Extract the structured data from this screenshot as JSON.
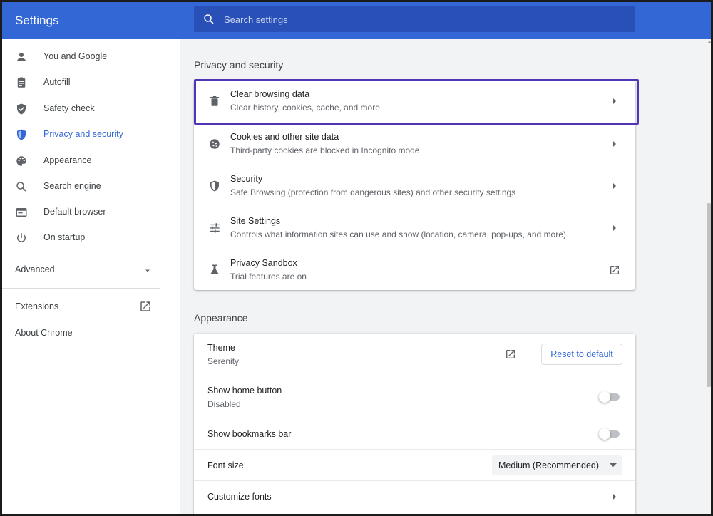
{
  "app": {
    "title": "Settings"
  },
  "search": {
    "placeholder": "Search settings"
  },
  "sidebar": {
    "items": [
      {
        "label": "You and Google",
        "icon": "person-icon"
      },
      {
        "label": "Autofill",
        "icon": "clipboard-icon"
      },
      {
        "label": "Safety check",
        "icon": "shield-check-icon"
      },
      {
        "label": "Privacy and security",
        "icon": "shield-icon",
        "active": true
      },
      {
        "label": "Appearance",
        "icon": "palette-icon"
      },
      {
        "label": "Search engine",
        "icon": "search-icon"
      },
      {
        "label": "Default browser",
        "icon": "browser-icon"
      },
      {
        "label": "On startup",
        "icon": "power-icon"
      }
    ],
    "advanced": "Advanced",
    "extensions": "Extensions",
    "about": "About Chrome"
  },
  "privacy": {
    "title": "Privacy and security",
    "rows": [
      {
        "title": "Clear browsing data",
        "subtitle": "Clear history, cookies, cache, and more",
        "icon": "trash-icon",
        "trailing": "arrow"
      },
      {
        "title": "Cookies and other site data",
        "subtitle": "Third-party cookies are blocked in Incognito mode",
        "icon": "cookie-icon",
        "trailing": "arrow"
      },
      {
        "title": "Security",
        "subtitle": "Safe Browsing (protection from dangerous sites) and other security settings",
        "icon": "shield-icon",
        "trailing": "arrow"
      },
      {
        "title": "Site Settings",
        "subtitle": "Controls what information sites can use and show (location, camera, pop-ups, and more)",
        "icon": "tune-icon",
        "trailing": "arrow"
      },
      {
        "title": "Privacy Sandbox",
        "subtitle": "Trial features are on",
        "icon": "flask-icon",
        "trailing": "external-link"
      }
    ]
  },
  "appearance": {
    "title": "Appearance",
    "theme": {
      "title": "Theme",
      "value": "Serenity",
      "reset_label": "Reset to default"
    },
    "home_button": {
      "title": "Show home button",
      "value": "Disabled",
      "enabled": false
    },
    "bookmarks_bar": {
      "title": "Show bookmarks bar",
      "enabled": false
    },
    "font_size": {
      "title": "Font size",
      "value": "Medium (Recommended)"
    },
    "customize_fonts": {
      "title": "Customize fonts"
    }
  },
  "colors": {
    "header": "#3367d6",
    "accent": "#3367d6",
    "highlight_box": "#5135b7",
    "page_bg": "#f1f3f4"
  }
}
